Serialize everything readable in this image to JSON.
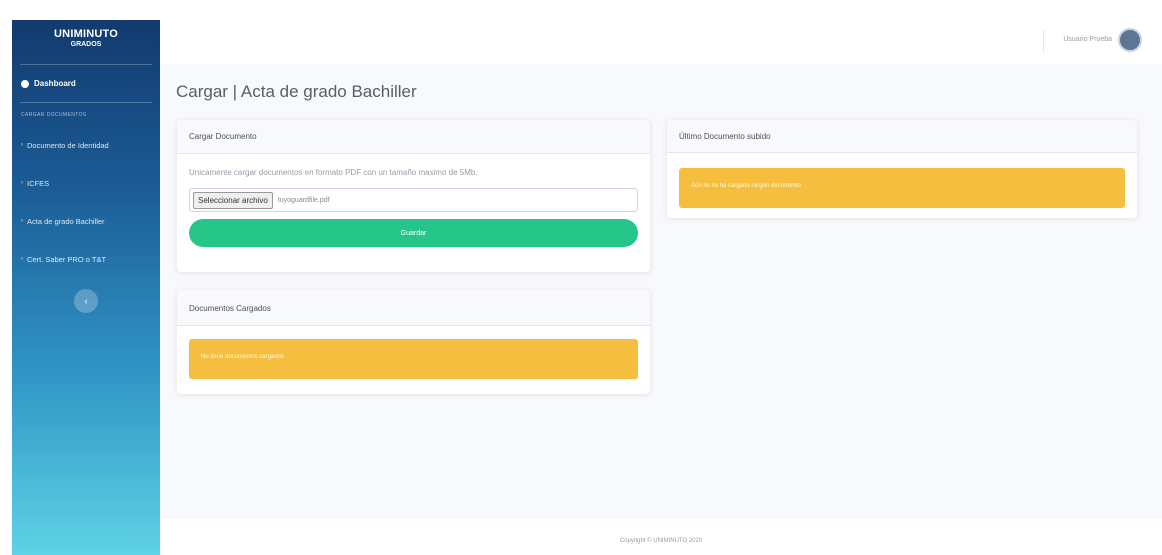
{
  "sidebar": {
    "brand_name": "UNIMINUTO",
    "brand_sub": "GRADOS",
    "dashboard_label": "Dashboard",
    "section_heading": "CARGAR DOCUMENTOS",
    "items": [
      {
        "label": "Documento de Identidad"
      },
      {
        "label": "ICFES"
      },
      {
        "label": "Acta de grado Bachiller"
      },
      {
        "label": "Cert. Saber PRO o T&T"
      }
    ],
    "toggle_icon": "chevron-left-icon"
  },
  "topbar": {
    "user_name": "Usuario Prueba",
    "avatar_icon": "user-avatar"
  },
  "main": {
    "page_title": "Cargar | Acta de grado Bachiller"
  },
  "upload_card": {
    "header": "Cargar Documento",
    "hint": "Unicamente cargar documentos en formato PDF con un tamaño maximo de 5Mb.",
    "file_button": "Seleccionar archivo",
    "file_name": "tuyoguardfile.pdf",
    "save_button": "Guardar"
  },
  "loaded_card": {
    "header": "Documentos Cargados",
    "alert": "No tiene documentos cargados"
  },
  "last_card": {
    "header": "Último Documento subido",
    "alert": "Aún no se ha cargado ningún documento"
  },
  "footer": {
    "copyright": "Copyright © UNIMINUTO 2020"
  },
  "colors": {
    "sidebar_top": "#123a6e",
    "sidebar_bottom": "#5ed2e6",
    "success": "#26c68a",
    "warning": "#f6be3f"
  }
}
